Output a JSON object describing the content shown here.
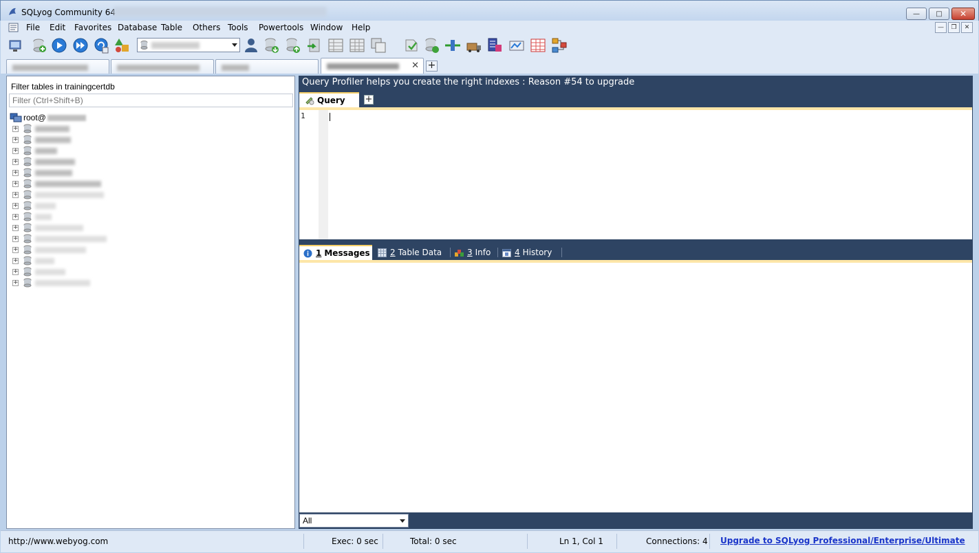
{
  "window": {
    "title": "SQLyog Community 64 -"
  },
  "menu": {
    "items": [
      "File",
      "Edit",
      "Favorites",
      "Database",
      "Table",
      "Others",
      "Tools",
      "Powertools",
      "Window",
      "Help"
    ]
  },
  "left_pane": {
    "filter_label": "Filter tables in trainingcertdb",
    "filter_placeholder": "Filter (Ctrl+Shift+B)",
    "root_label": "root@"
  },
  "editor": {
    "promo_text": "Query Profiler helps you create the right indexes : Reason #54 to upgrade",
    "query_tab_label": "Query",
    "line_number": "1"
  },
  "result_tabs": [
    {
      "num": "1",
      "label": "Messages"
    },
    {
      "num": "2",
      "label": "Table Data"
    },
    {
      "num": "3",
      "label": "Info"
    },
    {
      "num": "4",
      "label": "History"
    }
  ],
  "result_filter": {
    "selected": "All"
  },
  "status": {
    "url": "http://www.webyog.com",
    "exec": "Exec: 0 sec",
    "total": "Total: 0 sec",
    "position": "Ln 1, Col 1",
    "connections": "Connections: 4",
    "upgrade": "Upgrade to SQLyog Professional/Enterprise/Ultimate"
  },
  "colors": {
    "panel_dark": "#2e4463",
    "accent_tab": "#f5ce67",
    "link": "#1a35c9"
  },
  "icons": [
    "app-dolphin-icon",
    "new-connection-icon",
    "new-query-icon",
    "execute-icon",
    "execute-all-icon",
    "refresh-icon",
    "schema-icon",
    "database-icon",
    "user-icon",
    "import-icon",
    "export-icon",
    "backup-icon",
    "table-grid-icon",
    "schema-sync-icon",
    "data-sync-icon",
    "query-builder-icon",
    "designer-icon"
  ]
}
